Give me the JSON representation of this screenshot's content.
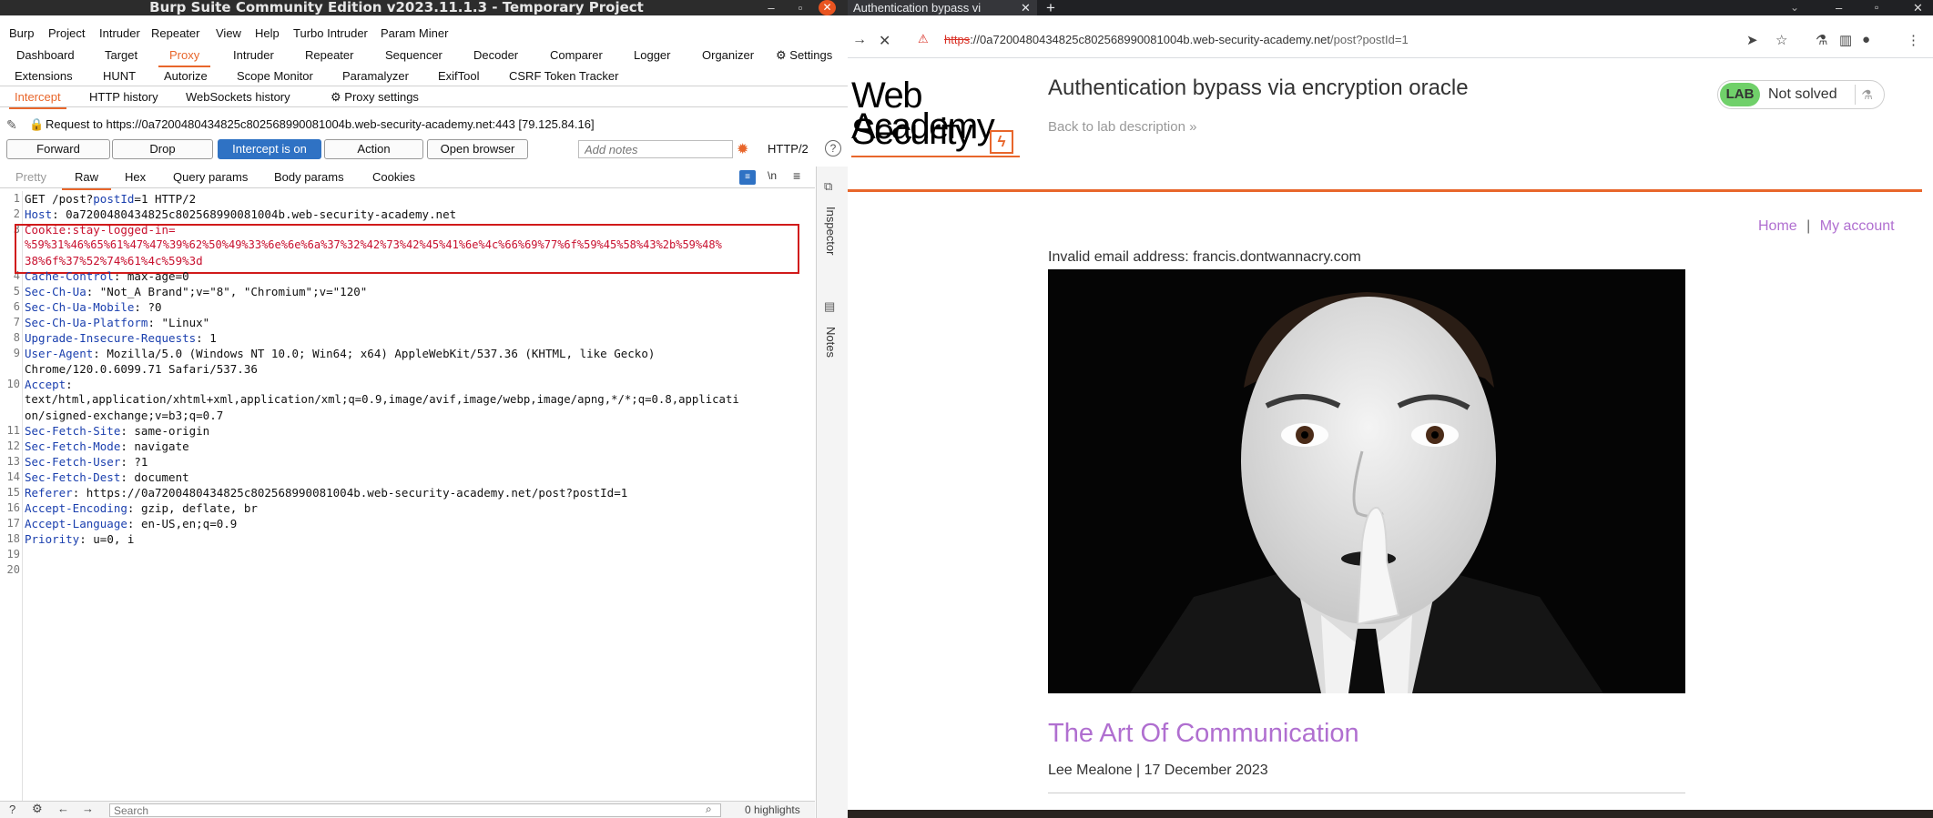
{
  "burp": {
    "title": "Burp Suite Community Edition v2023.11.1.3 - Temporary Project",
    "menu": [
      "Burp",
      "Project",
      "Intruder",
      "Repeater",
      "View",
      "Help",
      "Turbo Intruder",
      "Param Miner"
    ],
    "tool_tabs_row1": [
      "Dashboard",
      "Target",
      "Proxy",
      "Intruder",
      "Repeater",
      "Sequencer",
      "Decoder",
      "Comparer",
      "Logger",
      "Organizer",
      "Settings"
    ],
    "tool_tabs_row2": [
      "Extensions",
      "HUNT",
      "Autorize",
      "Scope Monitor",
      "Paramalyzer",
      "ExifTool",
      "CSRF Token Tracker"
    ],
    "active_tool_tab": "Proxy",
    "proxy_subtabs": [
      "Intercept",
      "HTTP history",
      "WebSockets history",
      "Proxy settings"
    ],
    "request_info": "Request to https://0a7200480434825c802568990081004b.web-security-academy.net:443  [79.125.84.16]",
    "buttons": {
      "forward": "Forward",
      "drop": "Drop",
      "intercept": "Intercept is on",
      "action": "Action",
      "open_browser": "Open browser",
      "notes_placeholder": "Add notes",
      "http_version": "HTTP/2"
    },
    "editor_tabs": [
      "Pretty",
      "Raw",
      "Hex",
      "Query params",
      "Body params",
      "Cookies"
    ],
    "editor_tab_active": "Raw",
    "editor_icons": [
      "\\n",
      "≡"
    ],
    "request_lines": {
      "l1": "GET /post?",
      "l1_param": "postId",
      "l1_rest": "=1 HTTP/2",
      "l2_key": "Host",
      "l2_val": ": 0a7200480434825c802568990081004b.web-security-academy.net",
      "l3_key": "Cookie",
      "l3_val": ":stay-logged-in=",
      "l3_cont1": "%59%31%46%65%61%47%47%39%62%50%49%33%6e%6e%6a%37%32%42%73%42%45%41%6e%4c%66%69%77%6f%59%45%58%43%2b%59%48%",
      "l3_cont2": "38%6f%37%52%74%61%4c%59%3d",
      "l4_key": "Cache-Control",
      "l4_val": ": max-age=0",
      "l5_key": "Sec-Ch-Ua",
      "l5_val": ": \"Not_A Brand\";v=\"8\", \"Chromium\";v=\"120\"",
      "l6_key": "Sec-Ch-Ua-Mobile",
      "l6_val": ": ?0",
      "l7_key": "Sec-Ch-Ua-Platform",
      "l7_val": ": \"Linux\"",
      "l8_key": "Upgrade-Insecure-Requests",
      "l8_val": ": 1",
      "l9_key": "User-Agent",
      "l9_val": ": Mozilla/5.0 (Windows NT 10.0; Win64; x64) AppleWebKit/537.36 (KHTML, like Gecko)",
      "l9_cont": "Chrome/120.0.6099.71 Safari/537.36",
      "l10_key": "Accept",
      "l10_val": ":",
      "l10_cont1": "text/html,application/xhtml+xml,application/xml;q=0.9,image/avif,image/webp,image/apng,*/*;q=0.8,applicati",
      "l10_cont2": "on/signed-exchange;v=b3;q=0.7",
      "l11_key": "Sec-Fetch-Site",
      "l11_val": ": same-origin",
      "l12_key": "Sec-Fetch-Mode",
      "l12_val": ": navigate",
      "l13_key": "Sec-Fetch-User",
      "l13_val": ": ?1",
      "l14_key": "Sec-Fetch-Dest",
      "l14_val": ": document",
      "l15_key": "Referer",
      "l15_val": ": https://0a7200480434825c802568990081004b.web-security-academy.net/post?postId=1",
      "l16_key": "Accept-Encoding",
      "l16_val": ": gzip, deflate, br",
      "l17_key": "Accept-Language",
      "l17_val": ": en-US,en;q=0.9",
      "l18_key": "Priority",
      "l18_val": ": u=0, i"
    },
    "line_numbers": [
      "1",
      "2",
      "3",
      "4",
      "5",
      "6",
      "7",
      "8",
      "9",
      "10",
      "11",
      "12",
      "13",
      "14",
      "15",
      "16",
      "17",
      "18",
      "19",
      "20"
    ],
    "side_rail": [
      "Inspector",
      "Notes"
    ],
    "search_placeholder": "Search",
    "highlights": "0 highlights"
  },
  "browser": {
    "tab_title": "Authentication bypass vi",
    "url_https": "https",
    "url_host": "://0a7200480434825c802568990081004b.web-security-academy.net",
    "url_path": "/post?postId=1"
  },
  "page": {
    "logo_line1": "Web Security",
    "logo_line2": "Academy",
    "lab_title": "Authentication bypass via encryption oracle",
    "back_link": "Back to lab description",
    "lab_badge": "LAB",
    "lab_status": "Not solved",
    "nav_home": "Home",
    "nav_sep": "|",
    "nav_account": "My account",
    "error_message": "Invalid email address: francis.dontwannacry.com",
    "post_title": "The Art Of Communication",
    "post_meta": "Lee Mealone | 17 December 2023"
  },
  "colors": {
    "burp_accent": "#e8662b",
    "intercept_button": "#2f72c4",
    "highlight_box": "#d11a1a",
    "lab_badge_green": "#70d06a",
    "post_title_purple": "#b06fd0"
  }
}
